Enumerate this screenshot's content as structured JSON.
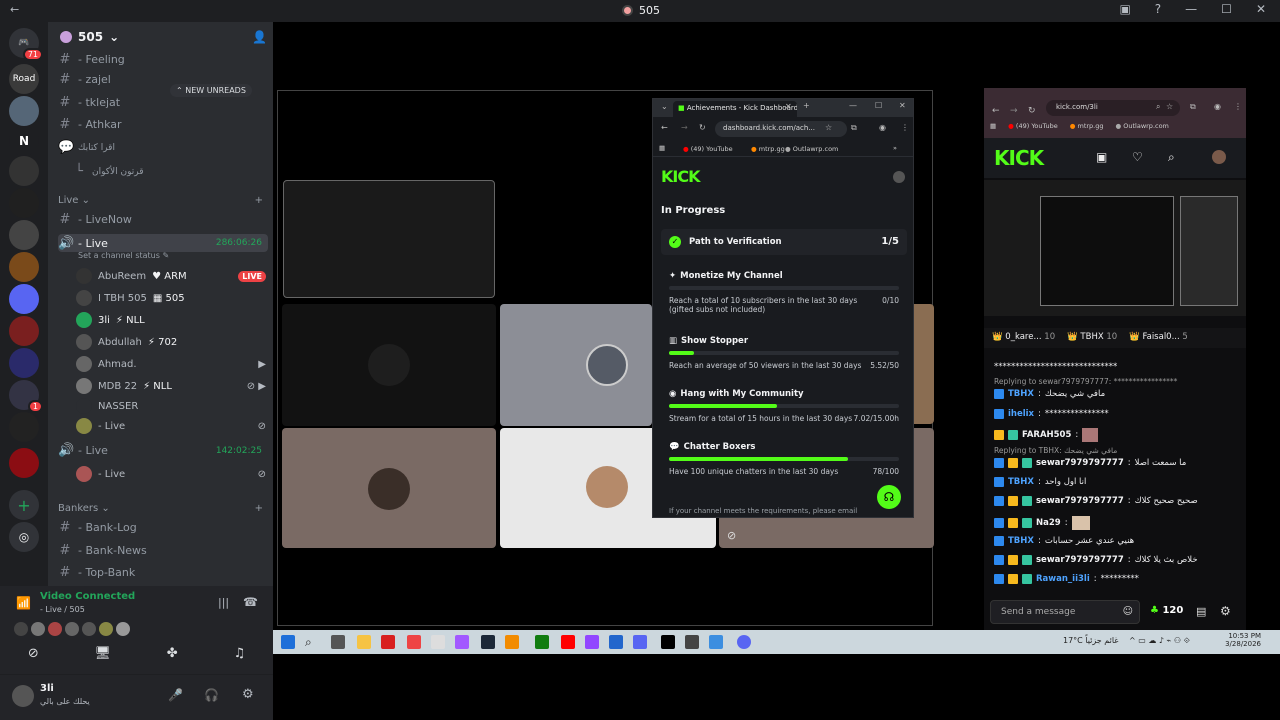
{
  "window": {
    "title": "505"
  },
  "server": {
    "name": "505",
    "new_unreads": "NEW UNREADS",
    "rail_badge": "71",
    "badge2": "1"
  },
  "channels": [
    {
      "label": "- Feeling",
      "type": "text"
    },
    {
      "label": "- zajel",
      "type": "text"
    },
    {
      "label": "- tklejat",
      "type": "text"
    },
    {
      "label": "- Athkar",
      "type": "text"
    },
    {
      "label": "اقرا كتابك",
      "type": "forum"
    },
    {
      "label": "قرتون الأكوان",
      "type": "thread"
    }
  ],
  "live_category": "Live",
  "live_channels": {
    "livenow": "- LiveNow",
    "live_active": "- Live",
    "live_timer": "286:06:26",
    "status_hint": "Set a channel status",
    "users": [
      {
        "name": "AbuReem",
        "tag": "ARM",
        "live": "LIVE"
      },
      {
        "name": "I TBH 505",
        "tag": "505"
      },
      {
        "name": "3li",
        "tag": "NLL"
      },
      {
        "name": "Abdullah",
        "tag": "702"
      },
      {
        "name": "Ahmad.",
        "tag": ""
      },
      {
        "name": "MDB 22",
        "tag": "NLL"
      },
      {
        "name": "NASSER",
        "tag": ""
      },
      {
        "name": "- Live",
        "tag": ""
      }
    ],
    "live2": "- Live",
    "live2_timer": "142:02:25",
    "live2_sub": "- Live"
  },
  "bankers_category": "Bankers",
  "bankers": [
    "- Bank-Log",
    "- Bank-News",
    "- Top-Bank"
  ],
  "voice": {
    "status": "Video Connected",
    "channel": "- Live / 505"
  },
  "me": {
    "name": "3li",
    "status": "يحلك على بالي"
  },
  "kick_popup": {
    "tab_title": "Achievements - Kick Dashboard",
    "url": "dashboard.kick.com/ach...",
    "bookmarks": [
      "(49) YouTube",
      "mtrp.gg",
      "Outlawrp.com"
    ],
    "logo": "KICK",
    "section": "In Progress",
    "path_title": "Path to Verification",
    "path_progress": "1/5",
    "achievements": [
      {
        "title": "Monetize My Channel",
        "desc": "Reach a total of 10 subscribers in the last 30 days (gifted subs not included)",
        "value": "0/10",
        "progress": 0.0
      },
      {
        "title": "Show Stopper",
        "desc": "Reach an average of 50 viewers in the last 30 days",
        "value": "5.52/50",
        "progress": 0.11
      },
      {
        "title": "Hang with My Community",
        "desc": "Stream for a total of 15 hours in the last 30 days",
        "value": "7.02/15.00h",
        "progress": 0.47
      },
      {
        "title": "Chatter Boxers",
        "desc": "Have 100 unique chatters in the last 30 days",
        "value": "78/100",
        "progress": 0.78
      }
    ],
    "footer": "If your channel meets the requirements, please email"
  },
  "kick_right": {
    "url": "kick.com/3li",
    "bookmarks": [
      "(49) YouTube",
      "mtrp.gg",
      "Outlawrp.com"
    ],
    "logo": "KICK",
    "top_chatters": [
      {
        "name": "0_kare...",
        "count": "10"
      },
      {
        "name": "TBHX",
        "count": "10"
      },
      {
        "name": "Faisal0...",
        "count": "5"
      }
    ],
    "chat": [
      {
        "reply": "",
        "name": "",
        "text": "*****************************"
      },
      {
        "reply": "Replying to sewar7979797777: *****************",
        "name": "TBHX",
        "text": "مافي شي يضحك"
      },
      {
        "reply": "",
        "name": "ihelix",
        "text": "***************"
      },
      {
        "reply": "",
        "name": "FARAH505",
        "text": ""
      },
      {
        "reply": "Replying to TBHX: مافي شي يضحك",
        "name": "sewar7979797777",
        "text": "ما سمعت اصلا"
      },
      {
        "reply": "",
        "name": "TBHX",
        "text": "انا اول واحد"
      },
      {
        "reply": "",
        "name": "sewar7979797777",
        "text": "صحيح صحيح كلاك"
      },
      {
        "reply": "",
        "name": "Na29",
        "text": ""
      },
      {
        "reply": "",
        "name": "TBHX",
        "text": "هنيي عندي عشر حسابات"
      },
      {
        "reply": "",
        "name": "sewar7979797777",
        "text": "خلاص بث يلا كلاك"
      },
      {
        "reply": "",
        "name": "Rawan_ii3li",
        "text": "*********"
      }
    ],
    "send_placeholder": "Send a message",
    "viewers": "120"
  },
  "taskbar": {
    "weather": "17°C",
    "weather_text": "غائم جزئياً",
    "time": "10:53 PM",
    "date": "3/28/2026"
  },
  "colors": {
    "kick_green": "#53fc18",
    "discord_bg": "#2b2d31",
    "rail_bg": "#1e1f22",
    "live_red": "#ed4245",
    "voice_green": "#23a55a"
  }
}
